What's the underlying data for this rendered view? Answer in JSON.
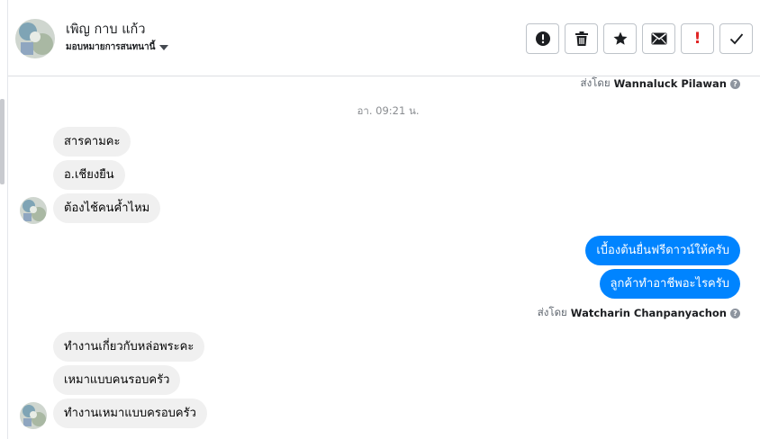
{
  "contact": {
    "name": "เพิญ กาบ แก้ว",
    "assign_label": "มอบหมายการสนทนานี้"
  },
  "toolbar": {
    "urgent_label": "!"
  },
  "conversation": {
    "sent_by_prefix": "ส่งโดย",
    "top_sender": "Wannaluck Pilawan",
    "timestamp": "อา. 09:21 น.",
    "incoming_group_1": [
      "สารคามคะ",
      "อ.เชียงยืน",
      "ต้องไช้คนค้ำไหม"
    ],
    "outgoing_group": [
      "เบื้องต้นยื่นฟรีดาวน์ให้ครับ",
      "ลูกค้าทำอาชีพอะไรครับ"
    ],
    "outgoing_sender": "Watcharin Chanpanyachon",
    "incoming_group_2": [
      "ทำงานเกี่ยวกับหล่อพระคะ",
      "เหมาแบบคนรอบครัว",
      "ทำงานเหมาแบบครอบครัว"
    ]
  },
  "colors": {
    "outgoing_bubble": "#0084ff",
    "incoming_bubble": "#f0f0f0",
    "urgent": "#e02424"
  },
  "icons": {
    "toolbar": [
      "alert-circle-icon",
      "trash-icon",
      "star-icon",
      "envelope-icon",
      "exclamation-icon",
      "checkmark-icon"
    ],
    "other": [
      "caret-down-icon",
      "help-icon"
    ]
  }
}
